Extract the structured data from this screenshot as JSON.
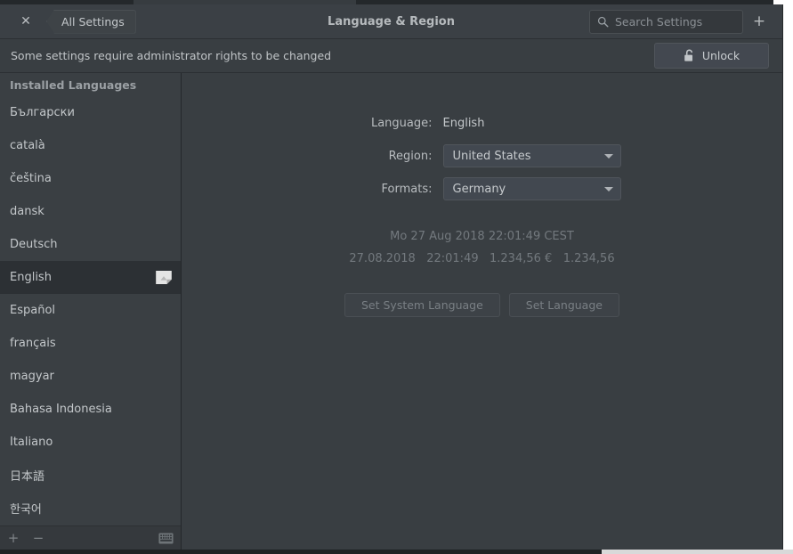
{
  "header": {
    "close_label": "✕",
    "back_label": "All Settings",
    "title": "Language & Region",
    "add_label": "+",
    "search": {
      "placeholder": "Search Settings",
      "value": ""
    }
  },
  "infobar": {
    "message": "Some settings require administrator rights to be changed",
    "unlock_label": "Unlock"
  },
  "sidebar": {
    "header": "Installed Languages",
    "selected": "English",
    "items": [
      {
        "label": "Български",
        "selected": false,
        "badge": false
      },
      {
        "label": "català",
        "selected": false,
        "badge": false
      },
      {
        "label": "čeština",
        "selected": false,
        "badge": false
      },
      {
        "label": "dansk",
        "selected": false,
        "badge": false
      },
      {
        "label": "Deutsch",
        "selected": false,
        "badge": false
      },
      {
        "label": "English",
        "selected": true,
        "badge": true
      },
      {
        "label": "Español",
        "selected": false,
        "badge": false
      },
      {
        "label": "français",
        "selected": false,
        "badge": false
      },
      {
        "label": "magyar",
        "selected": false,
        "badge": false
      },
      {
        "label": "Bahasa Indonesia",
        "selected": false,
        "badge": false
      },
      {
        "label": "Italiano",
        "selected": false,
        "badge": false
      },
      {
        "label": "日本語",
        "selected": false,
        "badge": false
      },
      {
        "label": "한국어",
        "selected": false,
        "badge": false
      }
    ],
    "toolbar": {
      "add_label": "+",
      "remove_label": "−",
      "keyboard_icon": "keyboard-icon"
    }
  },
  "main": {
    "language_label": "Language:",
    "language_value": "English",
    "region_label": "Region:",
    "region_value": "United States",
    "formats_label": "Formats:",
    "formats_value": "Germany",
    "preview_datetime": "Mo 27 Aug 2018 22:01:49 CEST",
    "preview_formats": "27.08.2018   22:01:49   1.234,56 €   1.234,56",
    "set_system_language_label": "Set System Language",
    "set_language_label": "Set Language"
  },
  "colors": {
    "window_bg": "#393e42",
    "header_bg": "#3b4045",
    "sidebar_bg": "#3a3f43",
    "selected_row_bg": "#2c3034",
    "text": "#c3c7ca",
    "muted_text": "#73797e"
  }
}
